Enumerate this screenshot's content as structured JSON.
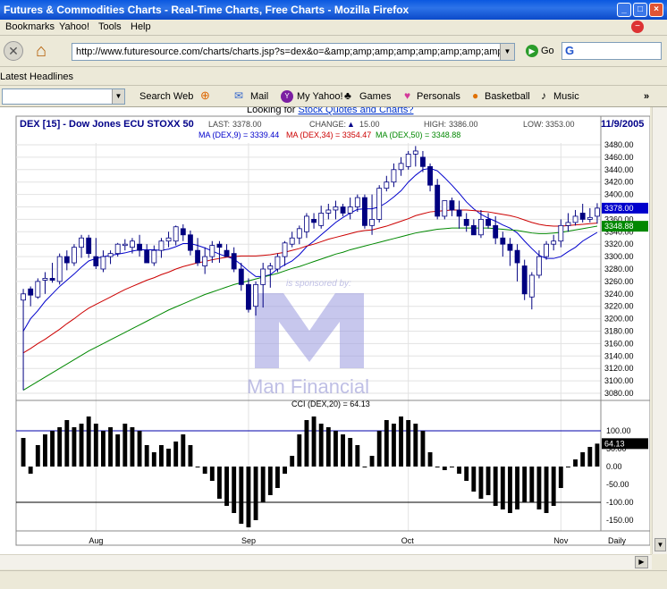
{
  "window": {
    "title": "Futures & Commodities Charts - Real-Time Charts, Free Charts - Mozilla Firefox"
  },
  "menu": {
    "items": [
      "Bookmarks",
      "Yahoo!",
      "Tools",
      "Help"
    ]
  },
  "nav": {
    "url": "http://www.futuresource.com/charts/charts.jsp?s=dex&o=&amp;amp;amp;amp;amp;amp;amp;amp;amp;a=D",
    "go_label": "Go",
    "search_glyph": "G"
  },
  "headlines": {
    "label": "Latest Headlines"
  },
  "toolbar": {
    "search_web": "Search Web",
    "mail": "Mail",
    "my_yahoo": "My Yahoo!",
    "games": "Games",
    "personals": "Personals",
    "basketball": "Basketball",
    "music": "Music"
  },
  "page": {
    "link_prefix": "Looking for ",
    "link_text": "Stock Quotes and Charts?"
  },
  "colors": {
    "ma9": "#0000cc",
    "ma34": "#cc0000",
    "ma50": "#008800",
    "up": "#ffffff",
    "down": "#000080"
  },
  "chart_data": {
    "type": "candlestick",
    "symbol": "DEX [15] - Dow Jones ECU STOXX 50",
    "date": "11/9/2005",
    "stats": {
      "last_label": "LAST:",
      "last": "3378.00",
      "change_label": "CHANGE:",
      "change": "15.00",
      "high_label": "HIGH:",
      "high": "3386.00",
      "low_label": "LOW:",
      "low": "3353.00"
    },
    "ma_labels": {
      "ma9": "MA (DEX,9) = 3339.44",
      "ma34": "MA (DEX,34) = 3354.47",
      "ma50": "MA (DEX,50) = 3348.88"
    },
    "price_flags": {
      "last": "3378.00",
      "ma50": "3348.88"
    },
    "price_axis": {
      "min": 3080,
      "max": 3480,
      "step": 20,
      "labels": [
        "3480.00",
        "3460.00",
        "3440.00",
        "3420.00",
        "3400.00",
        "3380.00",
        "3360.00",
        "3340.00",
        "3320.00",
        "3300.00",
        "3280.00",
        "3260.00",
        "3240.00",
        "3220.00",
        "3200.00",
        "3180.00",
        "3160.00",
        "3140.00",
        "3120.00",
        "3100.00",
        "3080.00"
      ]
    },
    "x_labels": [
      {
        "label": "Aug",
        "index": 10
      },
      {
        "label": "Sep",
        "index": 31
      },
      {
        "label": "Oct",
        "index": 53
      },
      {
        "label": "Nov",
        "index": 74
      },
      {
        "label": "Daily",
        "index": 81
      }
    ],
    "watermark": {
      "sponsor": "is sponsored by:",
      "brand": "Man Financial"
    },
    "candles": {
      "open": [
        3230,
        3248,
        3235,
        3262,
        3265,
        3260,
        3300,
        3290,
        3315,
        3330,
        3300,
        3280,
        3300,
        3305,
        3320,
        3315,
        3320,
        3310,
        3290,
        3310,
        3325,
        3325,
        3345,
        3335,
        3310,
        3285,
        3300,
        3320,
        3310,
        3305,
        3280,
        3255,
        3220,
        3255,
        3280,
        3280,
        3300,
        3320,
        3330,
        3340,
        3360,
        3350,
        3370,
        3375,
        3380,
        3370,
        3380,
        3395,
        3350,
        3360,
        3410,
        3420,
        3440,
        3445,
        3465,
        3460,
        3445,
        3415,
        3365,
        3390,
        3375,
        3360,
        3350,
        3335,
        3360,
        3350,
        3330,
        3320,
        3310,
        3285,
        3235,
        3270,
        3300,
        3320,
        3325,
        3350,
        3355,
        3370,
        3360,
        3365
      ],
      "high": [
        3248,
        3252,
        3265,
        3275,
        3290,
        3305,
        3310,
        3320,
        3335,
        3335,
        3330,
        3310,
        3310,
        3322,
        3328,
        3330,
        3335,
        3320,
        3318,
        3330,
        3340,
        3350,
        3352,
        3342,
        3330,
        3315,
        3325,
        3325,
        3320,
        3315,
        3290,
        3265,
        3260,
        3290,
        3290,
        3305,
        3325,
        3340,
        3350,
        3370,
        3370,
        3382,
        3385,
        3390,
        3385,
        3395,
        3400,
        3400,
        3400,
        3415,
        3430,
        3450,
        3460,
        3470,
        3478,
        3470,
        3450,
        3425,
        3390,
        3395,
        3390,
        3370,
        3360,
        3375,
        3370,
        3365,
        3340,
        3330,
        3320,
        3295,
        3275,
        3310,
        3325,
        3335,
        3360,
        3370,
        3375,
        3385,
        3378,
        3386
      ],
      "low": [
        3085,
        3220,
        3232,
        3240,
        3258,
        3255,
        3278,
        3285,
        3298,
        3298,
        3280,
        3275,
        3288,
        3300,
        3310,
        3305,
        3300,
        3300,
        3285,
        3298,
        3315,
        3318,
        3325,
        3302,
        3285,
        3272,
        3290,
        3290,
        3300,
        3275,
        3245,
        3210,
        3205,
        3218,
        3250,
        3275,
        3285,
        3315,
        3320,
        3330,
        3345,
        3345,
        3360,
        3360,
        3365,
        3360,
        3372,
        3345,
        3335,
        3355,
        3405,
        3412,
        3430,
        3440,
        3445,
        3436,
        3405,
        3360,
        3360,
        3365,
        3345,
        3340,
        3335,
        3330,
        3345,
        3320,
        3300,
        3285,
        3260,
        3230,
        3215,
        3265,
        3295,
        3310,
        3315,
        3340,
        3350,
        3355,
        3355,
        3353
      ],
      "close": [
        3240,
        3238,
        3260,
        3265,
        3262,
        3300,
        3290,
        3315,
        3330,
        3305,
        3285,
        3300,
        3305,
        3320,
        3320,
        3325,
        3310,
        3290,
        3310,
        3325,
        3330,
        3348,
        3335,
        3310,
        3290,
        3300,
        3318,
        3315,
        3300,
        3280,
        3255,
        3215,
        3255,
        3280,
        3285,
        3300,
        3322,
        3330,
        3345,
        3365,
        3355,
        3370,
        3375,
        3380,
        3370,
        3380,
        3395,
        3350,
        3360,
        3410,
        3420,
        3440,
        3450,
        3465,
        3470,
        3445,
        3415,
        3365,
        3390,
        3375,
        3365,
        3350,
        3335,
        3360,
        3350,
        3330,
        3320,
        3310,
        3290,
        3240,
        3270,
        3300,
        3320,
        3325,
        3350,
        3355,
        3365,
        3360,
        3363,
        3378
      ]
    },
    "ma9": [
      3180,
      3200,
      3213,
      3228,
      3240,
      3252,
      3262,
      3272,
      3283,
      3293,
      3297,
      3300,
      3302,
      3304,
      3306,
      3309,
      3311,
      3311,
      3311,
      3310,
      3312,
      3316,
      3321,
      3321,
      3318,
      3314,
      3309,
      3304,
      3300,
      3296,
      3287,
      3277,
      3268,
      3268,
      3271,
      3280,
      3287,
      3293,
      3303,
      3316,
      3325,
      3335,
      3345,
      3355,
      3363,
      3370,
      3376,
      3377,
      3377,
      3380,
      3387,
      3396,
      3406,
      3420,
      3431,
      3440,
      3442,
      3438,
      3427,
      3415,
      3402,
      3388,
      3377,
      3368,
      3362,
      3357,
      3351,
      3346,
      3338,
      3325,
      3313,
      3302,
      3297,
      3297,
      3300,
      3308,
      3315,
      3325,
      3332,
      3339
    ],
    "ma34": [
      3145,
      3152,
      3160,
      3167,
      3175,
      3183,
      3192,
      3200,
      3209,
      3217,
      3223,
      3229,
      3235,
      3241,
      3247,
      3252,
      3257,
      3262,
      3266,
      3271,
      3275,
      3280,
      3284,
      3287,
      3290,
      3292,
      3295,
      3297,
      3299,
      3300,
      3301,
      3301,
      3301,
      3302,
      3303,
      3305,
      3307,
      3310,
      3313,
      3317,
      3320,
      3324,
      3328,
      3331,
      3334,
      3337,
      3340,
      3342,
      3343,
      3346,
      3349,
      3353,
      3357,
      3361,
      3366,
      3369,
      3372,
      3373,
      3374,
      3375,
      3375,
      3375,
      3374,
      3373,
      3372,
      3370,
      3368,
      3366,
      3363,
      3359,
      3355,
      3352,
      3350,
      3349,
      3349,
      3350,
      3351,
      3352,
      3353,
      3354
    ],
    "ma50": [
      3085,
      3092,
      3099,
      3106,
      3113,
      3120,
      3127,
      3134,
      3141,
      3148,
      3154,
      3160,
      3166,
      3172,
      3178,
      3184,
      3190,
      3196,
      3202,
      3208,
      3214,
      3219,
      3224,
      3229,
      3234,
      3239,
      3243,
      3247,
      3251,
      3255,
      3258,
      3261,
      3264,
      3267,
      3270,
      3273,
      3277,
      3281,
      3284,
      3288,
      3292,
      3296,
      3300,
      3304,
      3307,
      3311,
      3314,
      3317,
      3320,
      3323,
      3326,
      3329,
      3332,
      3335,
      3338,
      3340,
      3342,
      3344,
      3345,
      3346,
      3346,
      3346,
      3346,
      3346,
      3346,
      3345,
      3344,
      3343,
      3342,
      3340,
      3338,
      3337,
      3337,
      3338,
      3339,
      3341,
      3343,
      3345,
      3347,
      3349
    ],
    "cci": {
      "label": "CCI (DEX,20) = 64.13",
      "value_flag": "64.13",
      "axis_min": -180,
      "axis_max": 150,
      "axis_labels": [
        {
          "v": 100,
          "t": "100.00"
        },
        {
          "v": 50,
          "t": "50.00"
        },
        {
          "v": 0,
          "t": "0.00"
        },
        {
          "v": -50,
          "t": "-50.00"
        },
        {
          "v": -100,
          "t": "-100.00"
        },
        {
          "v": -150,
          "t": "-150.00"
        }
      ],
      "lines": [
        100,
        -100
      ],
      "values": [
        80,
        -20,
        60,
        90,
        100,
        110,
        130,
        110,
        120,
        140,
        120,
        100,
        110,
        90,
        120,
        110,
        100,
        60,
        40,
        60,
        50,
        70,
        90,
        60,
        0,
        -20,
        -40,
        -90,
        -110,
        -130,
        -160,
        -170,
        -150,
        -100,
        -80,
        -60,
        -20,
        30,
        90,
        130,
        140,
        120,
        110,
        100,
        90,
        80,
        60,
        0,
        30,
        100,
        130,
        120,
        140,
        130,
        120,
        100,
        40,
        0,
        -10,
        0,
        -20,
        -40,
        -70,
        -90,
        -80,
        -110,
        -120,
        -130,
        -120,
        -100,
        -100,
        -120,
        -130,
        -110,
        -60,
        0,
        20,
        40,
        55,
        64.13
      ]
    }
  }
}
